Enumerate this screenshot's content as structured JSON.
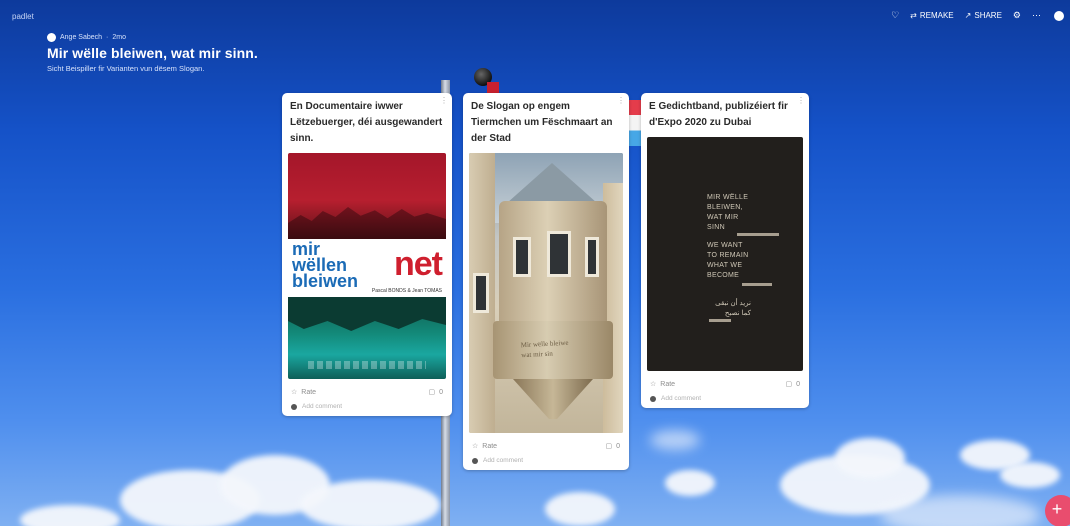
{
  "app": {
    "brand": "padlet"
  },
  "toolbar": {
    "remake_label": "REMAKE",
    "share_label": "SHARE",
    "heart_icon": "heart-icon",
    "remake_icon": "remake-icon",
    "share_icon": "share-icon",
    "settings_icon": "gear-icon",
    "more_icon": "more-icon"
  },
  "header": {
    "author": "Ange Sabech",
    "age": "2mo",
    "title": "Mir wëlle bleiwen, wat mir sinn.",
    "subtitle": "Sicht Beispiller fir Varianten vun dësem Slogan."
  },
  "cards": [
    {
      "title": "En Documentaire iwwer Lëtzebuerger, déi ausgewandert sinn.",
      "media": {
        "line1": "mir",
        "line2": "wëllen",
        "line3": "bleiwen",
        "line4": "net",
        "credit": "Pascal BONDS & Jean TOMAS"
      },
      "react_label": "Rate",
      "comment_count": "0",
      "comment_placeholder": "Add comment"
    },
    {
      "title": "De Slogan op engem Tiermchen um Fëschmaart an der Stad",
      "media": {
        "inscription_1": "Mir wëlle bleiwe",
        "inscription_2": "wat mir sin"
      },
      "react_label": "Rate",
      "comment_count": "0",
      "comment_placeholder": "Add comment"
    },
    {
      "title": "E Gedichtband, publizéiert fir d'Expo 2020 zu Dubai",
      "media": {
        "lines": [
          "MIR WËLLE",
          "BLEIWEN,",
          "WAT MIR",
          "SINN",
          "",
          "WE WANT",
          "TO REMAIN",
          "WHAT WE",
          "BECOME"
        ],
        "arabic": [
          "نريد أن نبقى",
          "كما نصبح"
        ]
      },
      "react_label": "Rate",
      "comment_count": "0",
      "comment_placeholder": "Add comment"
    }
  ],
  "fab": {
    "label": "+"
  },
  "colors": {
    "background": "#1552c8",
    "fab": "#e94d6e"
  }
}
